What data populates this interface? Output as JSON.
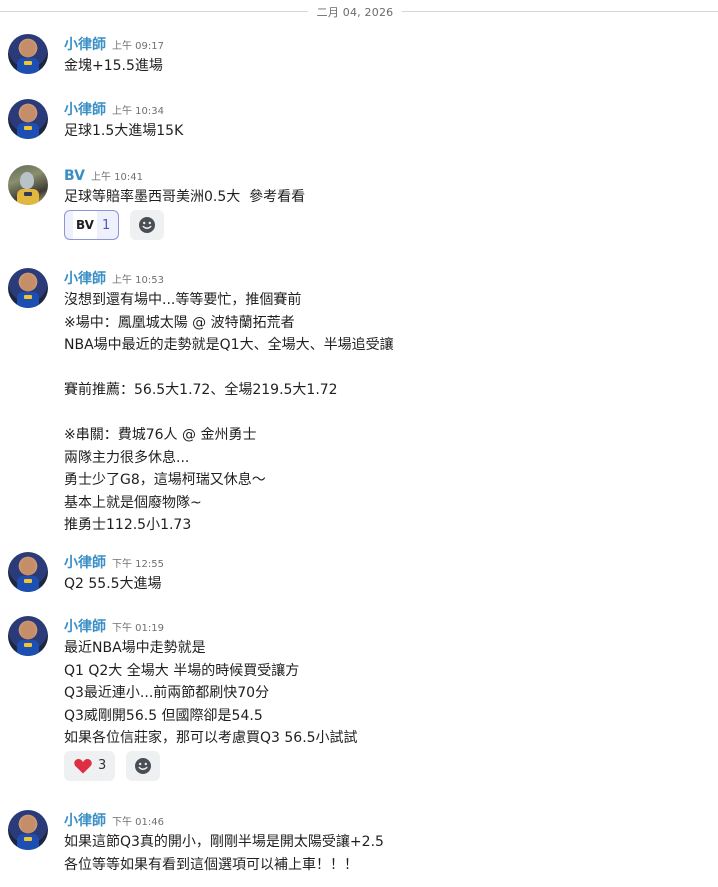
{
  "date_divider": "二月 04, 2026",
  "messages": [
    {
      "user": "小律師",
      "time": "上午 09:17",
      "text": "金塊+15.5進場"
    },
    {
      "user": "小律師",
      "time": "上午 10:34",
      "text": "足球1.5大進場15K"
    },
    {
      "user": "BV",
      "time": "上午 10:41",
      "text": "足球等賠率墨西哥美洲0.5大  參考看看",
      "reactions": [
        {
          "emoji": "BV",
          "count": "1",
          "active": true
        }
      ]
    },
    {
      "user": "小律師",
      "time": "上午 10:53",
      "text": "沒想到還有場中...等等要忙，推個賽前\n※場中：鳳凰城太陽 @ 波特蘭拓荒者\nNBA場中最近的走勢就是Q1大、全場大、半場追受讓\n\n賽前推薦：56.5大1.72、全場219.5大1.72\n\n※串關：費城76人 @ 金州勇士\n兩隊主力很多休息...\n勇士少了G8，這場柯瑞又休息～\n基本上就是個廢物隊~\n推勇士112.5小1.73"
    },
    {
      "user": "小律師",
      "time": "下午 12:55",
      "text": "Q2 55.5大進場"
    },
    {
      "user": "小律師",
      "time": "下午 01:19",
      "text": "最近NBA場中走勢就是\nQ1 Q2大 全場大 半場的時候買受讓方\nQ3最近連小...前兩節都刷快70分\nQ3威剛開56.5 但國際卻是54.5\n如果各位信莊家，那可以考慮買Q3 56.5小試試",
      "reactions": [
        {
          "emoji": "heart",
          "count": "3",
          "active": false
        }
      ]
    },
    {
      "user": "小律師",
      "time": "下午 01:46",
      "text": "如果這節Q3真的開小，剛剛半場是開太陽受讓+2.5\n各位等等如果有看到這個選項可以補上車！！！"
    }
  ],
  "colors": {
    "username": "#3a8fc6",
    "reaction_active_border": "#8c95d8",
    "reaction_active_bg": "#eef0fb",
    "heart": "#dd2e44"
  },
  "icons": {
    "add_reaction": "add-reaction-icon",
    "heart": "heart-icon"
  }
}
